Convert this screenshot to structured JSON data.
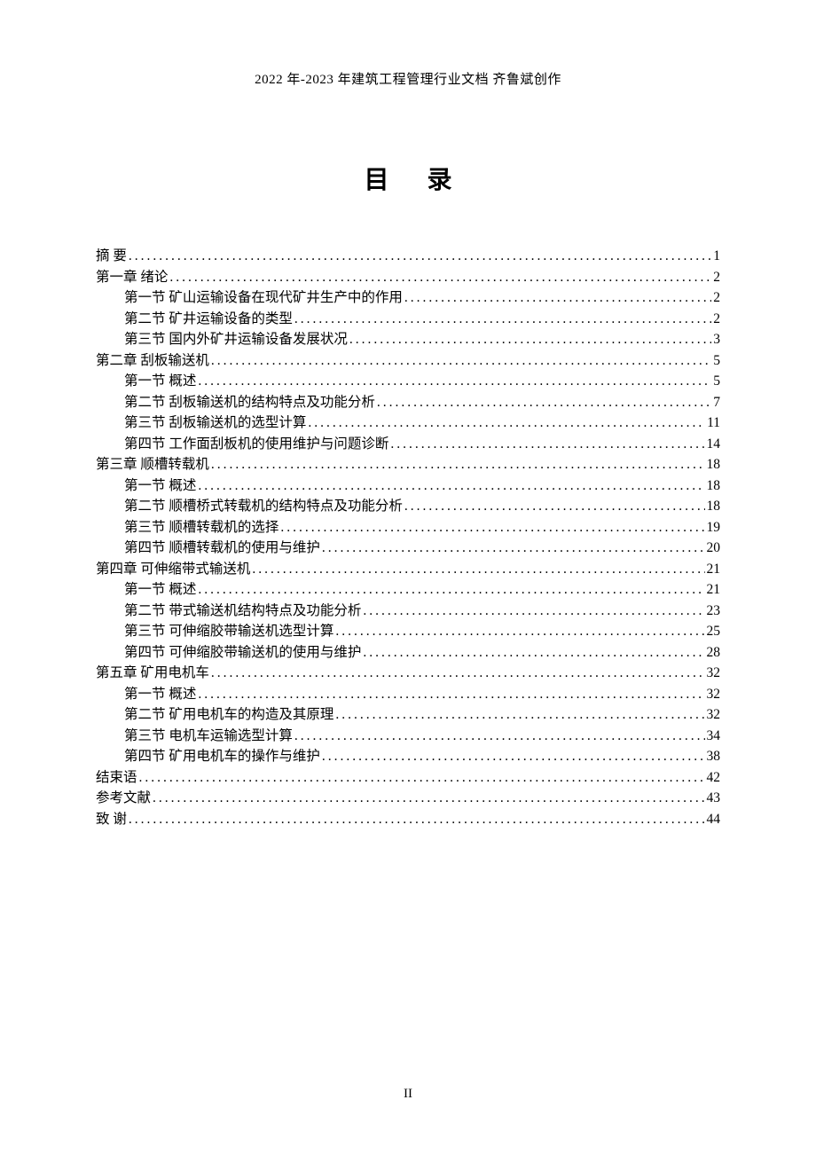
{
  "header": "2022 年-2023 年建筑工程管理行业文档  齐鲁斌创作",
  "title": "目  录",
  "page_number": "II",
  "toc": [
    {
      "label": "摘      要",
      "page": "1",
      "indent": false
    },
    {
      "label": "第一章  绪论",
      "page": "2",
      "indent": false
    },
    {
      "label": "第一节   矿山运输设备在现代矿井生产中的作用",
      "page": "2",
      "indent": true
    },
    {
      "label": "第二节     矿井运输设备的类型",
      "page": "2",
      "indent": true
    },
    {
      "label": "第三节     国内外矿井运输设备发展状况",
      "page": "3",
      "indent": true
    },
    {
      "label": "第二章   刮板输送机",
      "page": "5",
      "indent": false
    },
    {
      "label": "第一节  概述",
      "page": "5",
      "indent": true
    },
    {
      "label": "第二节  刮板输送机的结构特点及功能分析",
      "page": "7",
      "indent": true
    },
    {
      "label": "第三节  刮板输送机的选型计算",
      "page": "11",
      "indent": true
    },
    {
      "label": "第四节  工作面刮板机的使用维护与问题诊断",
      "page": "14",
      "indent": true
    },
    {
      "label": "第三章   顺槽转载机",
      "page": "18",
      "indent": false
    },
    {
      "label": "第一节  概述",
      "page": "18",
      "indent": true
    },
    {
      "label": "第二节  顺槽桥式转载机的结构特点及功能分析",
      "page": "18",
      "indent": true
    },
    {
      "label": "第三节  顺槽转载机的选择",
      "page": "19",
      "indent": true
    },
    {
      "label": "第四节  顺槽转载机的使用与维护",
      "page": "20",
      "indent": true
    },
    {
      "label": "第四章   可伸缩带式输送机",
      "page": "21",
      "indent": false
    },
    {
      "label": "第一节  概述",
      "page": "21",
      "indent": true
    },
    {
      "label": "第二节  带式输送机结构特点及功能分析",
      "page": "23",
      "indent": true
    },
    {
      "label": "第三节  可伸缩胶带输送机选型计算",
      "page": "25",
      "indent": true
    },
    {
      "label": "第四节  可伸缩胶带输送机的使用与维护",
      "page": "28",
      "indent": true
    },
    {
      "label": "第五章   矿用电机车",
      "page": "32",
      "indent": false
    },
    {
      "label": "第一节  概述",
      "page": "32",
      "indent": true
    },
    {
      "label": "第二节  矿用电机车的构造及其原理",
      "page": "32",
      "indent": true
    },
    {
      "label": "第三节  电机车运输选型计算",
      "page": "34",
      "indent": true
    },
    {
      "label": "第四节  矿用电机车的操作与维护",
      "page": "38",
      "indent": true
    },
    {
      "label": "结束语",
      "page": "42",
      "indent": false
    },
    {
      "label": "参考文献",
      "page": "43",
      "indent": false
    },
    {
      "label": "致   谢",
      "page": "44",
      "indent": false
    }
  ]
}
